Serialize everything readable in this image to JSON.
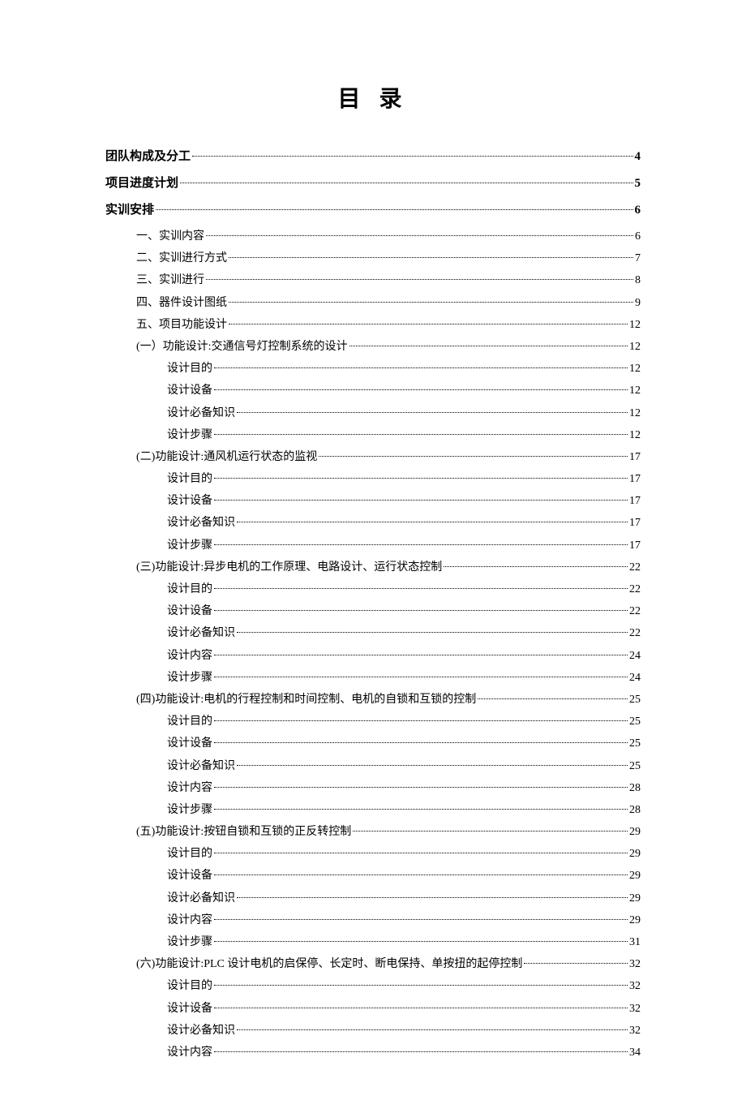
{
  "title": "目  录",
  "entries": [
    {
      "label": "团队构成及分工",
      "page": "4",
      "level": 0
    },
    {
      "label": "项目进度计划",
      "page": "5",
      "level": 0
    },
    {
      "label": "实训安排",
      "page": "6",
      "level": 0
    },
    {
      "label": "一、实训内容",
      "page": "6",
      "level": 1
    },
    {
      "label": "二、实训进行方式",
      "page": "7",
      "level": 1
    },
    {
      "label": "三、实训进行",
      "page": "8",
      "level": 1
    },
    {
      "label": "四、器件设计图纸",
      "page": "9",
      "level": 1
    },
    {
      "label": "五、项目功能设计",
      "page": "12",
      "level": 1
    },
    {
      "label": "(一）功能设计:交通信号灯控制系统的设计",
      "page": "12",
      "level": 2
    },
    {
      "label": "设计目的",
      "page": "12",
      "level": 3
    },
    {
      "label": "设计设备",
      "page": "12",
      "level": 3
    },
    {
      "label": "设计必备知识",
      "page": "12",
      "level": 3
    },
    {
      "label": "设计步骤",
      "page": "12",
      "level": 3
    },
    {
      "label": "(二)功能设计:通风机运行状态的监视",
      "page": "17",
      "level": 2
    },
    {
      "label": "设计目的",
      "page": "17",
      "level": 3
    },
    {
      "label": "设计设备",
      "page": "17",
      "level": 3
    },
    {
      "label": "设计必备知识",
      "page": "17",
      "level": 3
    },
    {
      "label": "设计步骤",
      "page": "17",
      "level": 3
    },
    {
      "label": "(三)功能设计:异步电机的工作原理、电路设计、运行状态控制",
      "page": "22",
      "level": 2
    },
    {
      "label": "设计目的",
      "page": "22",
      "level": 3
    },
    {
      "label": "设计设备",
      "page": "22",
      "level": 3
    },
    {
      "label": "设计必备知识",
      "page": "22",
      "level": 3
    },
    {
      "label": "设计内容",
      "page": "24",
      "level": 3
    },
    {
      "label": "设计步骤",
      "page": "24",
      "level": 3
    },
    {
      "label": "(四)功能设计:电机的行程控制和时间控制、电机的自锁和互锁的控制",
      "page": "25",
      "level": 2
    },
    {
      "label": "设计目的",
      "page": "25",
      "level": 3
    },
    {
      "label": "设计设备",
      "page": "25",
      "level": 3
    },
    {
      "label": "设计必备知识",
      "page": "25",
      "level": 3
    },
    {
      "label": "设计内容",
      "page": "28",
      "level": 3
    },
    {
      "label": "设计步骤",
      "page": "28",
      "level": 3
    },
    {
      "label": "(五)功能设计:按钮自锁和互锁的正反转控制",
      "page": "29",
      "level": 2
    },
    {
      "label": "设计目的",
      "page": "29",
      "level": 3
    },
    {
      "label": "设计设备",
      "page": "29",
      "level": 3
    },
    {
      "label": "设计必备知识",
      "page": "29",
      "level": 3
    },
    {
      "label": "设计内容",
      "page": "29",
      "level": 3
    },
    {
      "label": "设计步骤",
      "page": "31",
      "level": 3
    },
    {
      "label": "(六)功能设计:PLC 设计电机的启保停、长定时、断电保持、单按扭的起停控制",
      "page": "32",
      "level": 2
    },
    {
      "label": "设计目的",
      "page": "32",
      "level": 3
    },
    {
      "label": "设计设备",
      "page": "32",
      "level": 3
    },
    {
      "label": "设计必备知识",
      "page": "32",
      "level": 3
    },
    {
      "label": "设计内容",
      "page": "34",
      "level": 3
    }
  ]
}
